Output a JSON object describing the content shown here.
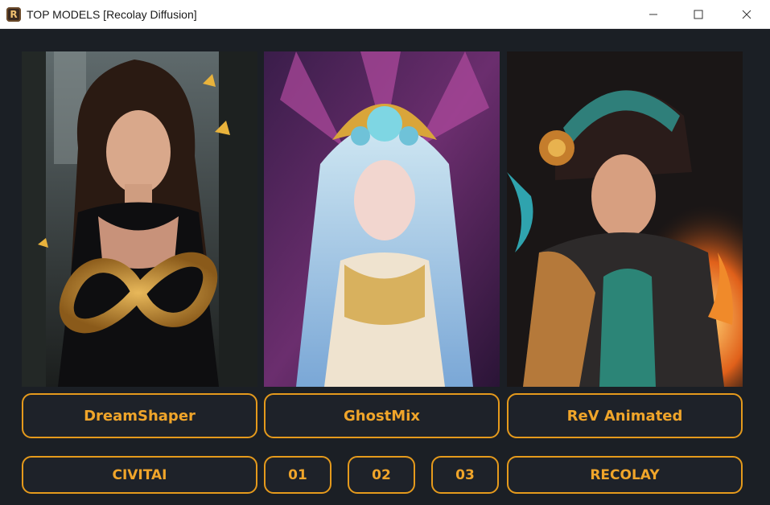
{
  "window": {
    "title": "TOP MODELS [Recolay Diffusion]",
    "app_icon_letter": "R"
  },
  "models": [
    {
      "label": "DreamShaper",
      "image": "portrait-woman-black-dress-gold-infinity-butterflies"
    },
    {
      "label": "GhostMix",
      "image": "portrait-woman-ornate-headdress-pastel-hair"
    },
    {
      "label": "ReV Animated",
      "image": "portrait-woman-sci-fi-armor-helmet-fire"
    }
  ],
  "bottom_row": {
    "civitai": "CIVITAI",
    "pages": [
      "01",
      "02",
      "03"
    ],
    "recolay": "RECOLAY"
  },
  "colors": {
    "background": "#1b1f25",
    "accent": "#e59a1c",
    "accent_text": "#f0a52a",
    "button_bg": "#1e2229"
  }
}
